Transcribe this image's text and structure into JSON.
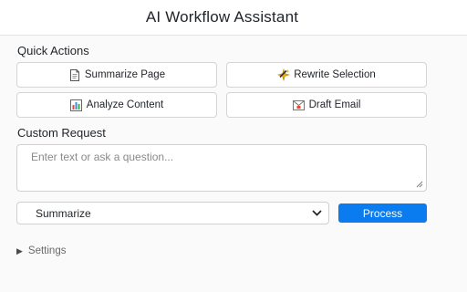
{
  "header": {
    "title": "AI Workflow Assistant"
  },
  "quick_actions": {
    "title": "Quick Actions",
    "buttons": [
      {
        "label": "Summarize Page",
        "icon": "document-icon"
      },
      {
        "label": "Rewrite Selection",
        "icon": "sparkle-icon"
      },
      {
        "label": "Analyze Content",
        "icon": "bar-chart-icon"
      },
      {
        "label": "Draft Email",
        "icon": "envelope-icon"
      }
    ]
  },
  "custom_request": {
    "title": "Custom Request",
    "placeholder": "Enter text or ask a question...",
    "value": ""
  },
  "mode_select": {
    "selected": "Summarize",
    "icon": "chevron-down-icon"
  },
  "process_button": {
    "label": "Process",
    "color": "#0b7bf0"
  },
  "settings": {
    "label": "Settings",
    "icon": "disclosure-triangle-icon"
  }
}
